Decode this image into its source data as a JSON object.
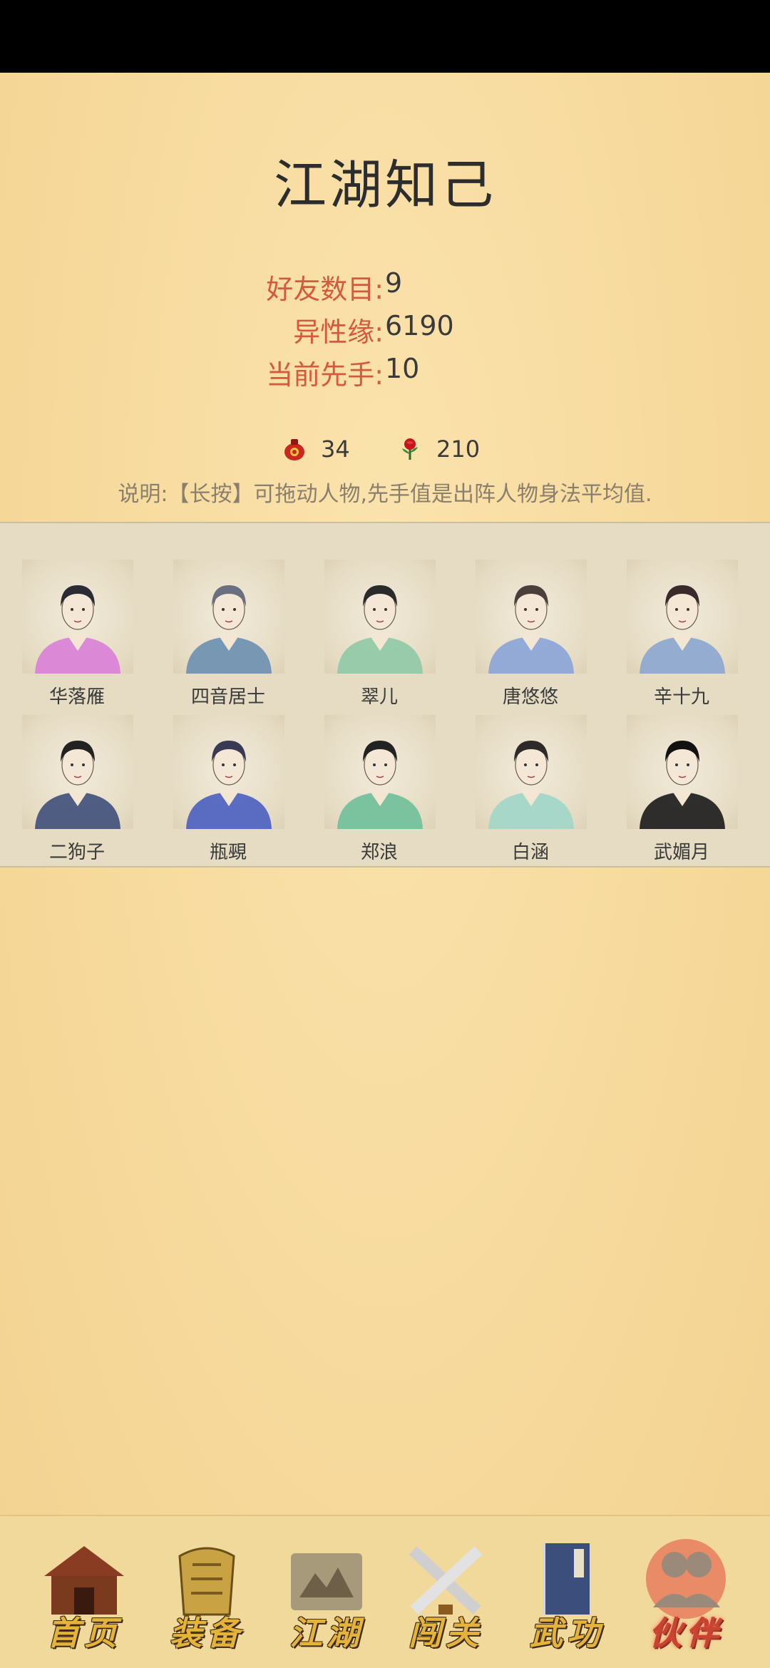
{
  "title": "江湖知己",
  "stats": [
    {
      "label": "好友数目:",
      "value": "9"
    },
    {
      "label": "异性缘:",
      "value": "6190"
    },
    {
      "label": "当前先手:",
      "value": "10"
    }
  ],
  "resources": {
    "gourd": {
      "icon": "wine-gourd-icon",
      "value": "34"
    },
    "rose": {
      "icon": "rose-icon",
      "value": "210"
    }
  },
  "note": "说明:【长按】可拖动人物,先手值是出阵人物身法平均值.",
  "friends": [
    {
      "name": "华落雁",
      "robe": "#d97fd8",
      "hair": "#2b2b33"
    },
    {
      "name": "四音居士",
      "robe": "#6a8fb0",
      "hair": "#6b7080"
    },
    {
      "name": "翠儿",
      "robe": "#8fc9a6",
      "hair": "#2a2a2a"
    },
    {
      "name": "唐悠悠",
      "robe": "#8aa4d8",
      "hair": "#4a3f3a"
    },
    {
      "name": "辛十九",
      "robe": "#8aa6d0",
      "hair": "#3a2a2a"
    },
    {
      "name": "二狗子",
      "robe": "#3f4f7a",
      "hair": "#222222"
    },
    {
      "name": "瓶覡",
      "robe": "#4a5fc0",
      "hair": "#3a3a55"
    },
    {
      "name": "郑浪",
      "robe": "#6fbf9a",
      "hair": "#222222"
    },
    {
      "name": "白涵",
      "robe": "#9fd6c8",
      "hair": "#2e2a2a"
    },
    {
      "name": "武媚月",
      "robe": "#1a1a1a",
      "hair": "#111111"
    }
  ],
  "nav": [
    {
      "label": "首页",
      "icon": "house-icon",
      "color": "#8a3c22"
    },
    {
      "label": "装备",
      "icon": "armor-icon",
      "color": "#c9a243"
    },
    {
      "label": "江湖",
      "icon": "map-scroll-icon",
      "color": "#a79a7a"
    },
    {
      "label": "闯关",
      "icon": "crossed-swords-icon",
      "color": "#cfcfcf"
    },
    {
      "label": "武功",
      "icon": "martial-book-icon",
      "color": "#3c4f7c"
    },
    {
      "label": "伙伴",
      "icon": "partners-icon",
      "color": "#9b8a7a",
      "active": true
    }
  ]
}
